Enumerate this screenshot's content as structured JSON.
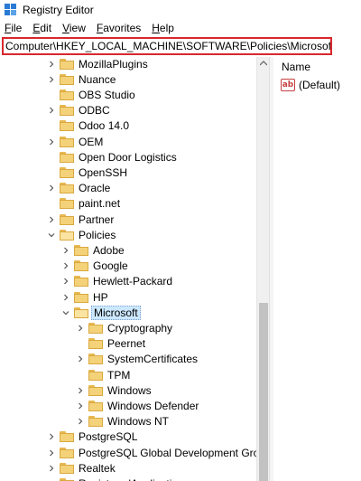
{
  "window": {
    "title": "Registry Editor"
  },
  "menu": [
    {
      "u": "F",
      "rest": "ile"
    },
    {
      "u": "E",
      "rest": "dit"
    },
    {
      "u": "V",
      "rest": "iew"
    },
    {
      "u": "F",
      "rest": "avorites"
    },
    {
      "u": "H",
      "rest": "elp"
    }
  ],
  "address": {
    "value": "Computer\\HKEY_LOCAL_MACHINE\\SOFTWARE\\Policies\\Microsoft"
  },
  "tree": [
    {
      "label": "MozillaPlugins",
      "level": 0,
      "chevron": "right"
    },
    {
      "label": "Nuance",
      "level": 0,
      "chevron": "right"
    },
    {
      "label": "OBS Studio",
      "level": 0,
      "chevron": "none"
    },
    {
      "label": "ODBC",
      "level": 0,
      "chevron": "right"
    },
    {
      "label": "Odoo 14.0",
      "level": 0,
      "chevron": "none"
    },
    {
      "label": "OEM",
      "level": 0,
      "chevron": "right"
    },
    {
      "label": "Open Door Logistics",
      "level": 0,
      "chevron": "none"
    },
    {
      "label": "OpenSSH",
      "level": 0,
      "chevron": "none"
    },
    {
      "label": "Oracle",
      "level": 0,
      "chevron": "right"
    },
    {
      "label": "paint.net",
      "level": 0,
      "chevron": "none"
    },
    {
      "label": "Partner",
      "level": 0,
      "chevron": "right"
    },
    {
      "label": "Policies",
      "level": 0,
      "chevron": "down"
    },
    {
      "label": "Adobe",
      "level": 1,
      "chevron": "right"
    },
    {
      "label": "Google",
      "level": 1,
      "chevron": "right"
    },
    {
      "label": "Hewlett-Packard",
      "level": 1,
      "chevron": "right"
    },
    {
      "label": "HP",
      "level": 1,
      "chevron": "right"
    },
    {
      "label": "Microsoft",
      "level": 1,
      "chevron": "down",
      "selected": true
    },
    {
      "label": "Cryptography",
      "level": 2,
      "chevron": "right"
    },
    {
      "label": "Peernet",
      "level": 2,
      "chevron": "none"
    },
    {
      "label": "SystemCertificates",
      "level": 2,
      "chevron": "right"
    },
    {
      "label": "TPM",
      "level": 2,
      "chevron": "none"
    },
    {
      "label": "Windows",
      "level": 2,
      "chevron": "right"
    },
    {
      "label": "Windows Defender",
      "level": 2,
      "chevron": "right"
    },
    {
      "label": "Windows NT",
      "level": 2,
      "chevron": "right"
    },
    {
      "label": "PostgreSQL",
      "level": 0,
      "chevron": "right"
    },
    {
      "label": "PostgreSQL Global Development Group",
      "level": 0,
      "chevron": "right"
    },
    {
      "label": "Realtek",
      "level": 0,
      "chevron": "right"
    },
    {
      "label": "RegisteredApplications",
      "level": 0,
      "chevron": "none"
    }
  ],
  "values": {
    "header_name": "Name",
    "rows": [
      {
        "icon": "ab",
        "name": "(Default)"
      }
    ]
  },
  "colors": {
    "address_border": "#d9272e",
    "selection": "#cce8ff",
    "folder": "#f4d27a"
  }
}
